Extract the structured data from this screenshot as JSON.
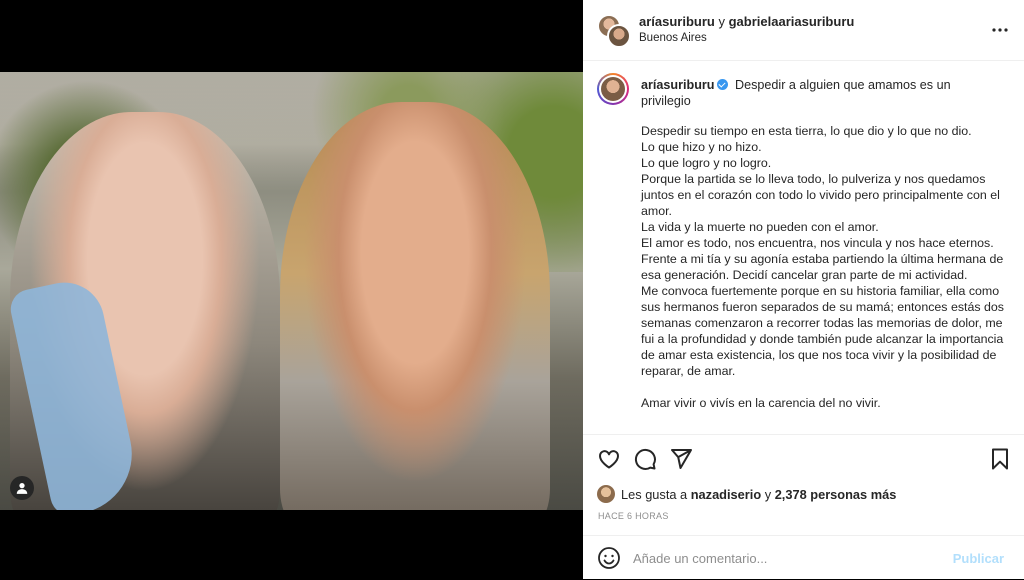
{
  "header": {
    "user1": "aríasuriburu",
    "conjunction": "y",
    "user2": "gabrielaariasuriburu",
    "location": "Buenos Aires"
  },
  "caption": {
    "username": "aríasuriburu",
    "title": "Despedir a alguien que amamos es un privilegio",
    "body": "Despedir su tiempo en esta tierra, lo que dio y lo que no dio.\nLo que hizo y no hizo.\nLo que logro y no logro.\nPorque la partida se lo lleva todo, lo pulveriza y nos quedamos juntos en el corazón con todo lo vivido pero principalmente con el amor.\nLa vida y la muerte no pueden con el amor.\nEl amor es todo, nos encuentra, nos vincula y nos hace eternos.\nFrente a mi tía y su agonía estaba partiendo la última hermana de esa generación. Decidí cancelar gran parte de mi actividad.\nMe convoca fuertemente porque en su historia familiar, ella como sus hermanos fueron separados de su mamá; entonces estás dos semanas comenzaron a recorrer todas las memorias de dolor, me fui a la profundidad y donde también pude alcanzar la importancia de amar esta existencia, los que nos toca vivir y la posibilidad de reparar, de amar.\n\nAmar vivir o vivís en la carencia del no vivir."
  },
  "likes": {
    "prefix": "Les gusta a",
    "user": "nazadiserio",
    "conjunction": "y",
    "others": "2,378 personas más"
  },
  "timestamp": "HACE 6 HORAS",
  "comment": {
    "placeholder": "Añade un comentario...",
    "publish_label": "Publicar"
  },
  "icons": {
    "like": "heart-icon",
    "comment": "comment-icon",
    "share": "share-icon",
    "save": "bookmark-icon",
    "more": "more-icon",
    "emoji": "emoji-icon",
    "tagged": "user-tag-icon"
  },
  "colors": {
    "verified": "#3897f0",
    "publish_disabled": "#b2dffc",
    "secondary_text": "#8e8e8e"
  }
}
